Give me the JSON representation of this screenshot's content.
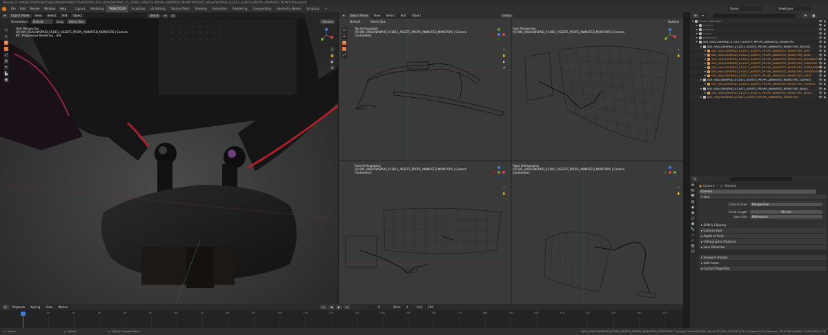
{
  "window": {
    "title": "Blender [C:\\PROJECTS\\PROJECTS\\BLENDER\\PROJECTS\\WORKING\\005_HAALOWSPAID_01_DD012_ASSETS_PROPS_ANIMATED_MONITORS\\005_HAALOWSPAID_011812_ASSETS_PROPS_ANIMATED_MONITORS.blend]"
  },
  "menus": [
    "File",
    "Edit",
    "Render",
    "Window",
    "Help"
  ],
  "workspaces": {
    "tabs": [
      "Layout",
      "Modeling",
      "PUBLITOUR",
      "Sculpting",
      "UV Editing",
      "Texture Paint",
      "Shading",
      "Animation",
      "Rendering",
      "Compositing",
      "Geometry Nodes",
      "Scripting"
    ],
    "active_index": 2
  },
  "topright": {
    "scene_label": "Scene",
    "viewlayer_label": "ViewLayer"
  },
  "viewport_main": {
    "mode": "Object Mode",
    "menus": [
      "View",
      "Select",
      "Add",
      "Object"
    ],
    "transform": "Global",
    "orientation_label": "Orientation",
    "orientation_value": "Default",
    "drag_label": "Drag",
    "drag_value": "Select Box",
    "options_label": "Options",
    "overlay_line1": "User Perspective",
    "overlay_line2": "(0) 005_HAALOWSPAID_011812_ASSETS_PROPS_ANIMATED_MONITORS | Camera",
    "overlay_line3": "Eff | Progressive Rendering .. 8%"
  },
  "viewport_quad": {
    "mode": "Object Mode",
    "menus": [
      "View",
      "Select",
      "Add",
      "Object"
    ],
    "transform": "Global",
    "orientation_value": "Default",
    "drag_value": "Select Box",
    "options_label": "Options",
    "top_left": {
      "label": "Top Orthographic",
      "object": "(0) 005_HAALOWSPAID_011812_ASSETS_PROPS_ANIMATED_MONITORS | Camera",
      "unit": "Centimeters"
    },
    "top_right": {
      "label": "User Perspective",
      "object": "(0) 005_HAALOWSPAID_011812_ASSETS_PROPS_ANIMATED_MONITORS | Camera"
    },
    "bottom_left": {
      "label": "Front Orthographic",
      "object": "(0) 005_HAALOWSPAID_011812_ASSETS_PROPS_ANIMATED_MONITORS | Camera",
      "unit": "Centimeters"
    },
    "bottom_right": {
      "label": "Right Orthographic",
      "object": "(0) 005_HAALOWSPAID_011812_ASSETS_PROPS_ANIMATED_MONITORS | Camera",
      "unit": "Centimeters"
    }
  },
  "outliner": {
    "search_placeholder": "",
    "rows": [
      {
        "name": "Scene Collection",
        "depth": 0,
        "color": "#9a9a9a"
      },
      {
        "name": "Camera",
        "depth": 1,
        "color": "#7a7a7a"
      },
      {
        "name": "Lighting",
        "depth": 1,
        "color": "#7a7a7a"
      },
      {
        "name": "Lamps",
        "depth": 1,
        "color": "#7a7a7a"
      },
      {
        "name": "Reference",
        "depth": 1,
        "color": "#7a7a7a"
      },
      {
        "name": "005_HAALOWSPAID_011812_ASSETS_PROPS_ANIMATED_MONITORS",
        "depth": 1,
        "color": "#e2e2e2"
      },
      {
        "name": "005_HAALOWSPAID_011812_ASSETS_PROPS_ANIMATED_MONITORS_RIGGED",
        "depth": 2,
        "color": "#e2e2e2"
      },
      {
        "name": "005_HAALOWSPAID_011812_ASSETS_PROPS_ANIMATED_MONITORS_ARM",
        "depth": 3,
        "color": "#e69a4c"
      },
      {
        "name": "005_HAALOWSPAID_011812_ASSETS_PROPS_ANIMATED_MONITORS_BASE",
        "depth": 3,
        "color": "#e69a4c"
      },
      {
        "name": "005_HAALOWSPAID_011812_ASSETS_PROPS_ANIMATED_MONITORS_BIGARMOUT",
        "depth": 3,
        "color": "#e69a4c"
      },
      {
        "name": "005_HAALOWSPAID_011812_ASSETS_PROPS_ANIMATED_MONITORS_FOREARM",
        "depth": 3,
        "color": "#e69a4c"
      },
      {
        "name": "005_HAALOWSPAID_011812_ASSETS_PROPS_ANIMATED_MONITORS_FOREARMZAB",
        "depth": 3,
        "color": "#e69a4c"
      },
      {
        "name": "005_HAALOWSPAID_011812_ASSETS_PROPS_ANIMATED_MONITORS_HANDMOTION",
        "depth": 3,
        "color": "#e69a4c"
      },
      {
        "name": "005_HAALOWSPAID_011812_ASSETS_PROPS_ANIMATED_MONITORS_JOINT",
        "depth": 3,
        "color": "#e69a4c"
      },
      {
        "name": "005_HAALOWSPAID_011812_ASSETS_PROPS_ANIMATED_MONITORS_CURVED",
        "depth": 2,
        "color": "#e2e2e2"
      },
      {
        "name": "005_HAALOWSPAID_011812_ASSETS_PROPS_ANIMATED_MONITORS_CURVED",
        "depth": 3,
        "color": "#e69a4c"
      },
      {
        "name": "005_HAALOWSPAID_011812_ASSETS_PROPS_ANIMATED_MONITORS_SMALL",
        "depth": 2,
        "color": "#e2e2e2"
      },
      {
        "name": "005_HAALOWSPAID_011812_ASSETS_PROPS_ANIMATED_MONITORS_SMALL",
        "depth": 3,
        "color": "#e69a4c"
      },
      {
        "name": "005_HAALOWSPAID_011812_ASSETS_PROPS_ANIMATED_MONITORS",
        "depth": 2,
        "color": "#e69a4c"
      }
    ]
  },
  "properties": {
    "breadcrumb_obj": "Camera",
    "breadcrumb_data": "Camera",
    "datablock": "Camera",
    "lens_panel": "Lens",
    "camera_type_label": "Camera Type",
    "camera_type_value": "Perspective",
    "focal_length_label": "Focal Length",
    "focal_length_value": "50 mm",
    "lens_unit_label": "Lens Unit",
    "lens_unit_value": "Millimeters",
    "shift_label": "Shift & Clipping",
    "sub_panels": [
      "Camera Safe",
      "Depth of Field",
      "Orthographic Distance",
      "Lens Distortion"
    ],
    "viewport_display": "Viewport Display",
    "safe_areas": "Safe Areas",
    "custom_properties": "Custom Properties"
  },
  "timeline": {
    "playback_label": "Playback",
    "keying_label": "Keying",
    "view_label": "View",
    "marker_label": "Marker",
    "current_frame": "0",
    "start_label": "Start",
    "start_value": "1",
    "end_label": "End",
    "end_value": "250",
    "ticks": [
      "0",
      "10",
      "20",
      "30",
      "40",
      "50",
      "60",
      "70",
      "80",
      "90",
      "100",
      "110",
      "120",
      "130",
      "140",
      "150",
      "160",
      "170",
      "180",
      "190",
      "200",
      "210",
      "220",
      "230",
      "240",
      "250"
    ]
  },
  "statusbar": {
    "left": [
      "Select",
      "Rotate",
      "Object Context Menu"
    ],
    "right": "005_HAALOWSPAID_011812_ASSETS_PROPS_ANIMATED_MONITORS | Camera | Verts:93,536 | Faces:77,243 | Tris:157,240 | Objects:0/11 | Memory: 78.0 MiB | VRAM: 1.5/8.0 GiB | 3.6"
  }
}
